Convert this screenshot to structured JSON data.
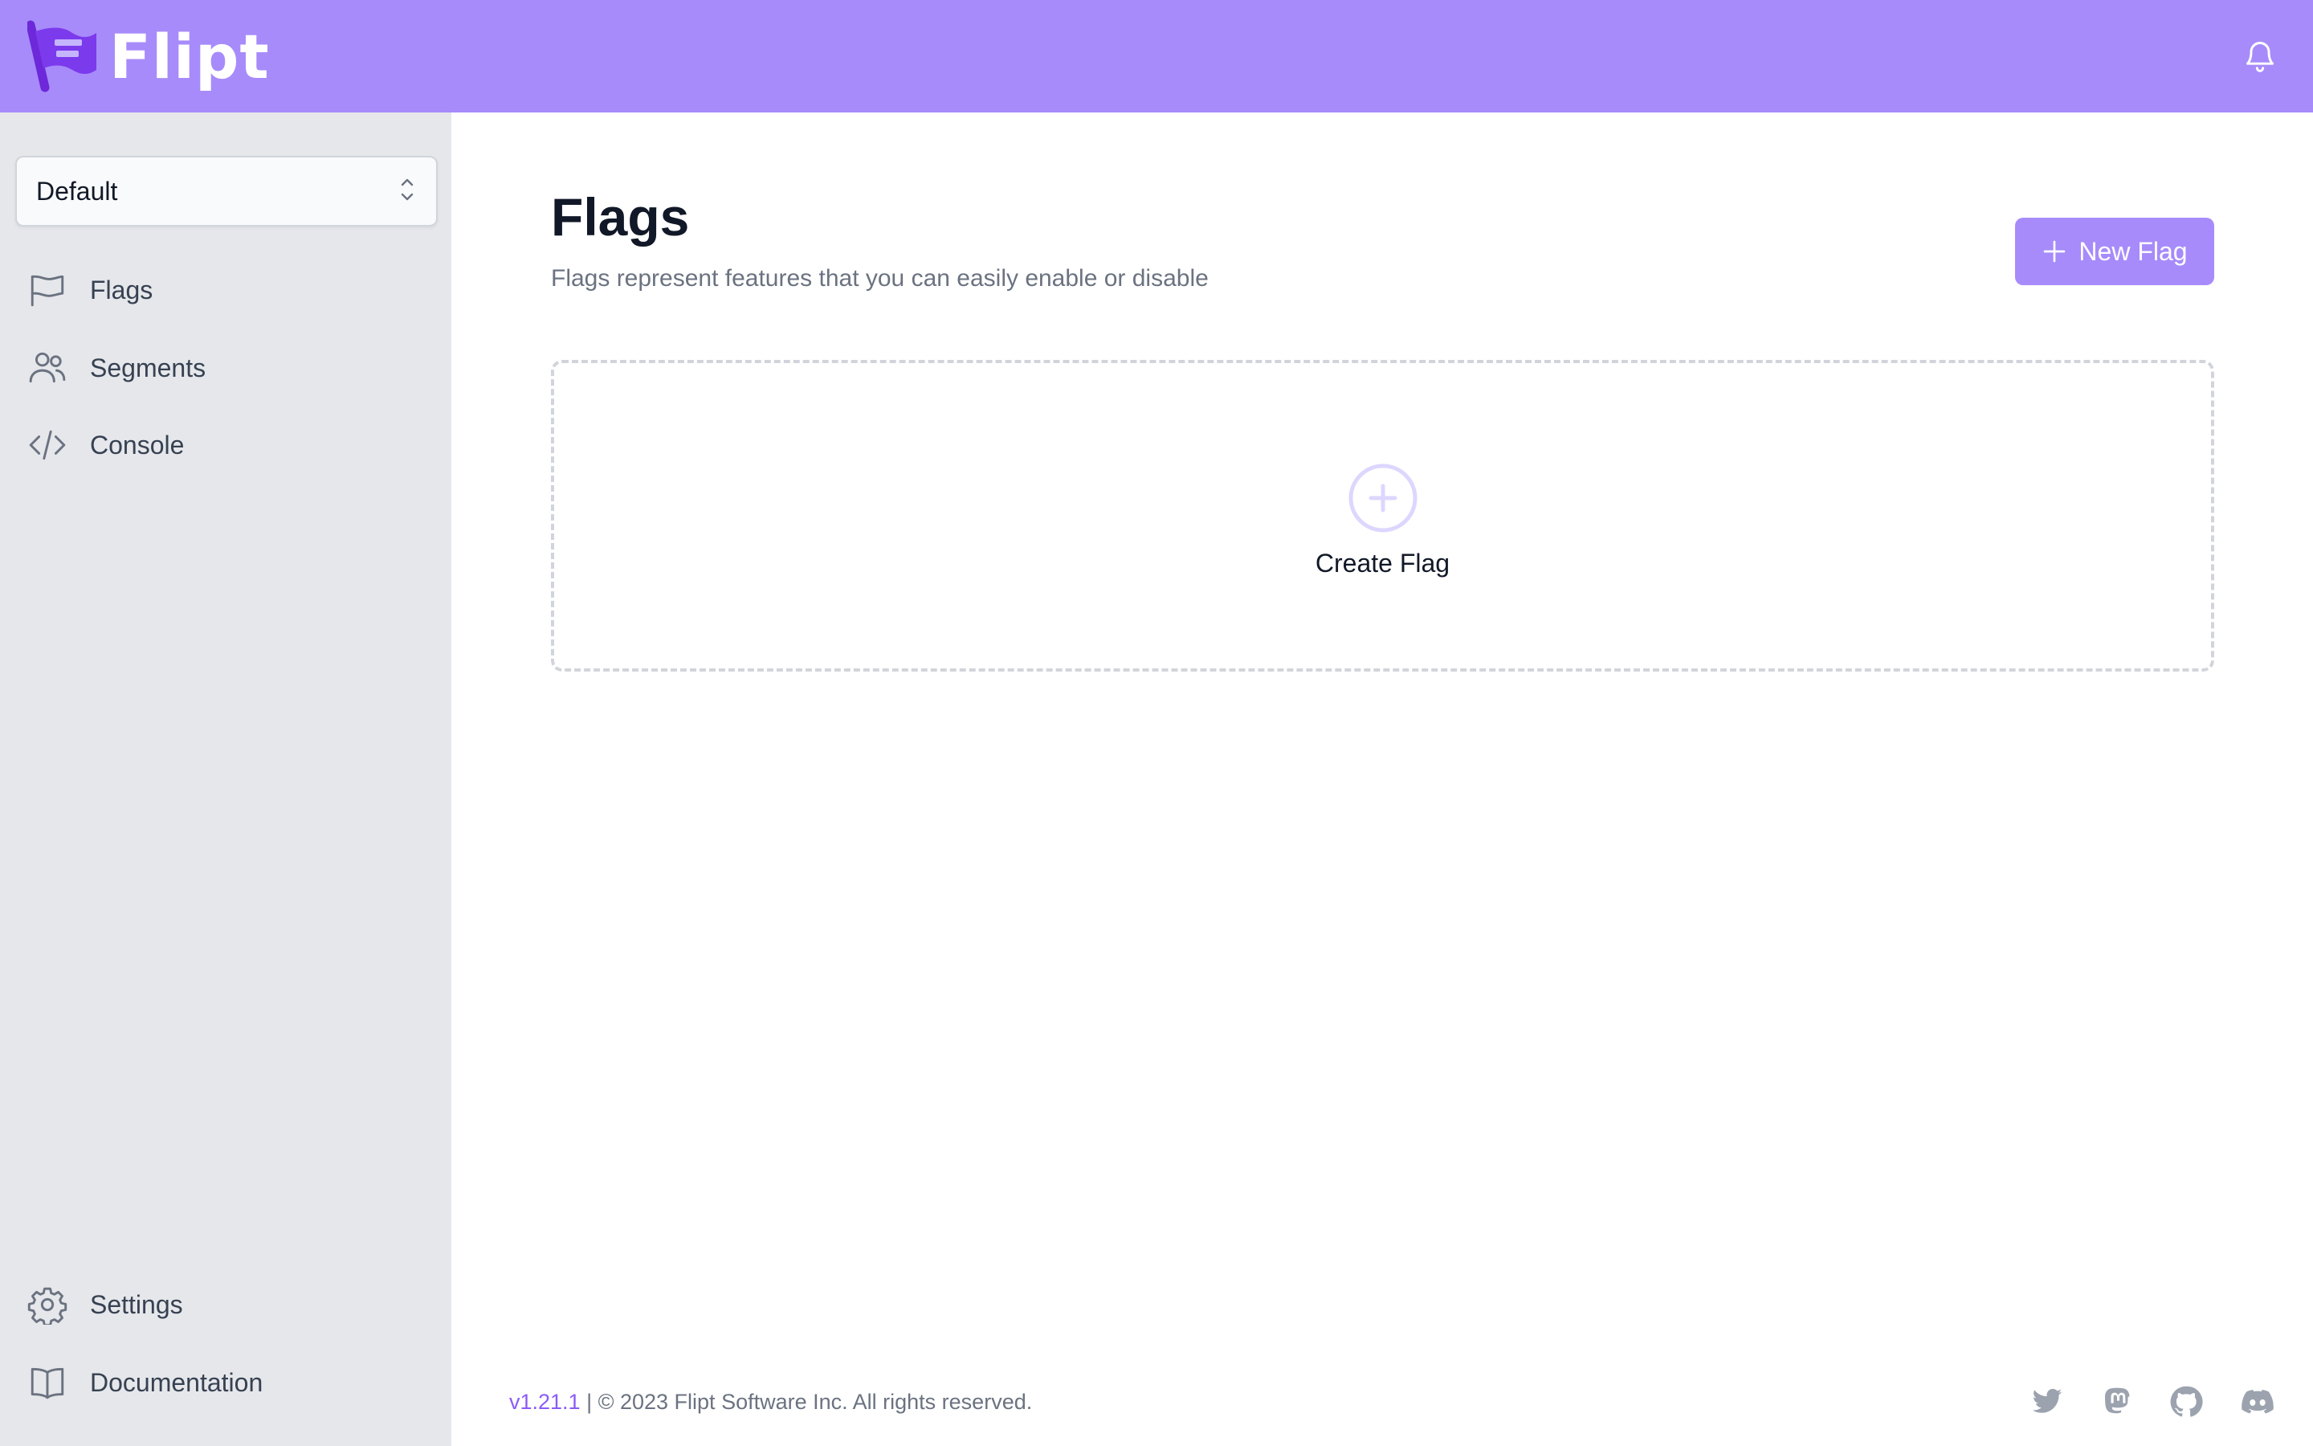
{
  "app": {
    "name": "Flipt"
  },
  "sidebar": {
    "namespace_selected": "Default",
    "items": [
      {
        "label": "Flags",
        "icon": "flag-icon"
      },
      {
        "label": "Segments",
        "icon": "users-icon"
      },
      {
        "label": "Console",
        "icon": "code-icon"
      }
    ],
    "bottom_items": [
      {
        "label": "Settings",
        "icon": "gear-icon"
      },
      {
        "label": "Documentation",
        "icon": "book-icon"
      }
    ]
  },
  "main": {
    "title": "Flags",
    "subtitle": "Flags represent features that you can easily enable or disable",
    "new_button_label": "New Flag",
    "empty_state_label": "Create Flag"
  },
  "footer": {
    "version": "v1.21.1",
    "copyright": " | © 2023 Flipt Software Inc. All rights reserved.",
    "social_icons": [
      "twitter-icon",
      "mastodon-icon",
      "github-icon",
      "discord-icon"
    ]
  },
  "colors": {
    "accent": "#a78bfa",
    "sidebar_bg": "#e5e7eb",
    "logo_purple": "#7c3aed",
    "version_text": "#8b5cf6"
  }
}
